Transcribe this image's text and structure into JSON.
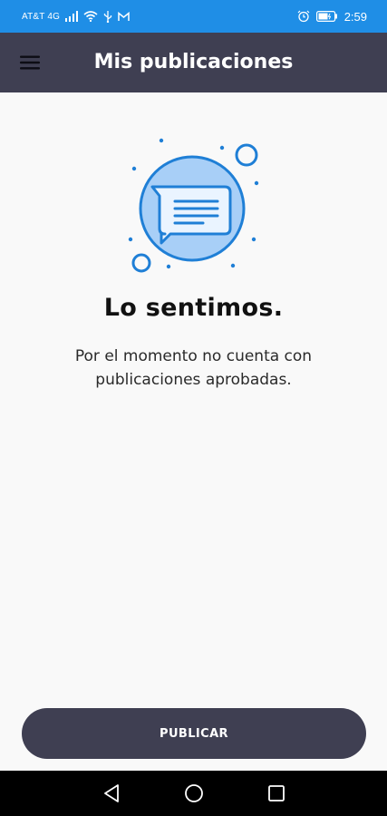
{
  "status_bar": {
    "carrier": "AT&T 4G",
    "time": "2:59",
    "icons": [
      "signal-icon",
      "wifi-icon",
      "usb-icon",
      "gmail-icon",
      "alarm-icon",
      "battery-icon"
    ]
  },
  "app_bar": {
    "title": "Mis publicaciones",
    "menu_icon": "hamburger-menu-icon"
  },
  "empty_state": {
    "illustration": "chat-message-icon",
    "title": "Lo sentimos.",
    "message": "Por el momento no cuenta con publicaciones aprobadas."
  },
  "actions": {
    "publish_label": "PUBLICAR"
  },
  "nav_bar": {
    "keys": [
      "back-icon",
      "home-icon",
      "recents-icon"
    ]
  },
  "colors": {
    "status_bar": "#1f8ee6",
    "app_bar": "#3f3f52",
    "button": "#3f3f52",
    "accent": "#1f7fd6",
    "background": "#f9f9f9"
  }
}
